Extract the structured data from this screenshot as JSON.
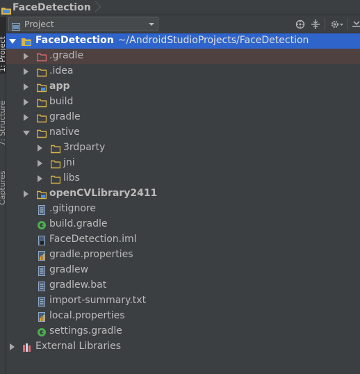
{
  "breadcrumb": {
    "title": "FaceDetection"
  },
  "sidebar": {
    "tabs": [
      {
        "label": "1: Project"
      },
      {
        "label": "7: Structure"
      },
      {
        "label": "Captures"
      }
    ]
  },
  "panel": {
    "view_selector": "Project",
    "icons": [
      "sync-icon",
      "collapse-all-icon",
      "gear-icon",
      "hide-icon"
    ]
  },
  "tree": {
    "root": {
      "name": "FaceDetection",
      "path": "~/AndroidStudioProjects/FaceDetection"
    },
    "items": [
      {
        "label": ".gradle"
      },
      {
        "label": ".idea"
      },
      {
        "label": "app"
      },
      {
        "label": "build"
      },
      {
        "label": "gradle"
      },
      {
        "label": "native"
      },
      {
        "label": "3rdparty"
      },
      {
        "label": "jni"
      },
      {
        "label": "libs"
      },
      {
        "label": "openCVLibrary2411"
      },
      {
        "label": ".gitignore"
      },
      {
        "label": "build.gradle"
      },
      {
        "label": "FaceDetection.iml"
      },
      {
        "label": "gradle.properties"
      },
      {
        "label": "gradlew"
      },
      {
        "label": "gradlew.bat"
      },
      {
        "label": "import-summary.txt"
      },
      {
        "label": "local.properties"
      },
      {
        "label": "settings.gradle"
      },
      {
        "label": "External Libraries"
      }
    ]
  },
  "colors": {
    "background": "#3c3f41",
    "selection": "#2f65ca",
    "folder": "#d9b54a",
    "excluded_folder": "#e06c75",
    "gradle_green": "#4caf50"
  }
}
